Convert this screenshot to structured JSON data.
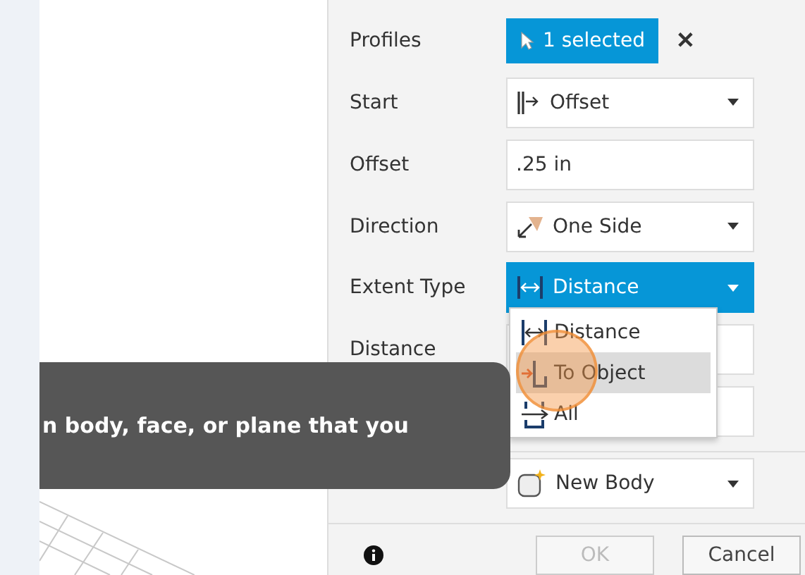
{
  "profiles": {
    "label": "Profiles",
    "button": "1 selected",
    "clear": "✕"
  },
  "rows": [
    {
      "kind": "select",
      "label": "Start",
      "value": "Offset",
      "active": false
    },
    {
      "kind": "text",
      "label": "Offset",
      "value": ".25 in"
    },
    {
      "kind": "select",
      "label": "Direction",
      "value": "One Side",
      "active": false
    },
    {
      "kind": "select",
      "label": "Extent Type",
      "value": "Distance",
      "active": true
    },
    {
      "kind": "text",
      "label": "Distance"
    },
    {
      "kind": "text"
    },
    {
      "kind": "select",
      "value": "New Body",
      "active": false
    }
  ],
  "menu": [
    {
      "label": "Distance",
      "selected": false
    },
    {
      "label": "To Object",
      "selected": true
    },
    {
      "label": "All",
      "selected": false
    }
  ],
  "tooltip": "n body, face, or plane that you",
  "footer": {
    "ok": "OK",
    "ok_disabled": true,
    "cancel": "Cancel"
  }
}
